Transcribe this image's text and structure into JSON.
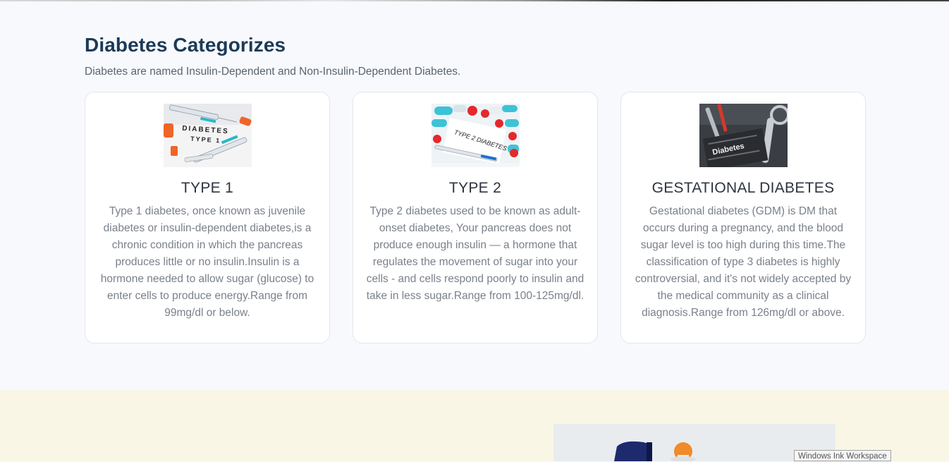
{
  "section": {
    "title": "Diabetes Categorizes",
    "subtitle": "Diabetes are named Insulin-Dependent and Non-Insulin-Dependent Diabetes."
  },
  "cards": [
    {
      "title": "TYPE 1",
      "text": "Type 1 diabetes, once known as juvenile diabetes or insulin-dependent diabetes,is a chronic condition in which the pancreas produces little or no insulin.Insulin is a hormone needed to allow sugar (glucose) to enter cells to produce energy.Range from 99mg/dl or below.",
      "image_label_line1": "DIABETES",
      "image_label_line2": "TYPE 1"
    },
    {
      "title": "TYPE 2",
      "text": "Type 2 diabetes used to be known as adult-onset diabetes, Your pancreas does not produce enough insulin — a hormone that regulates the movement of sugar into your cells - and cells respond poorly to insulin and take in less sugar.Range from 100-125mg/dl.",
      "image_label": "TYPE 2 DIABETES"
    },
    {
      "title": "GESTATIONAL DIABETES",
      "text": "Gestational diabetes (GDM) is DM that occurs during a pregnancy, and the blood sugar level is too high during this time.The classification of type 3 diabetes is highly controversial, and it's not widely accepted by the medical community as a clinical diagnosis.Range from 126mg/dl or above.",
      "image_label": "Diabetes"
    }
  ],
  "overlay": {
    "ink_workspace": "Windows Ink Workspace"
  }
}
